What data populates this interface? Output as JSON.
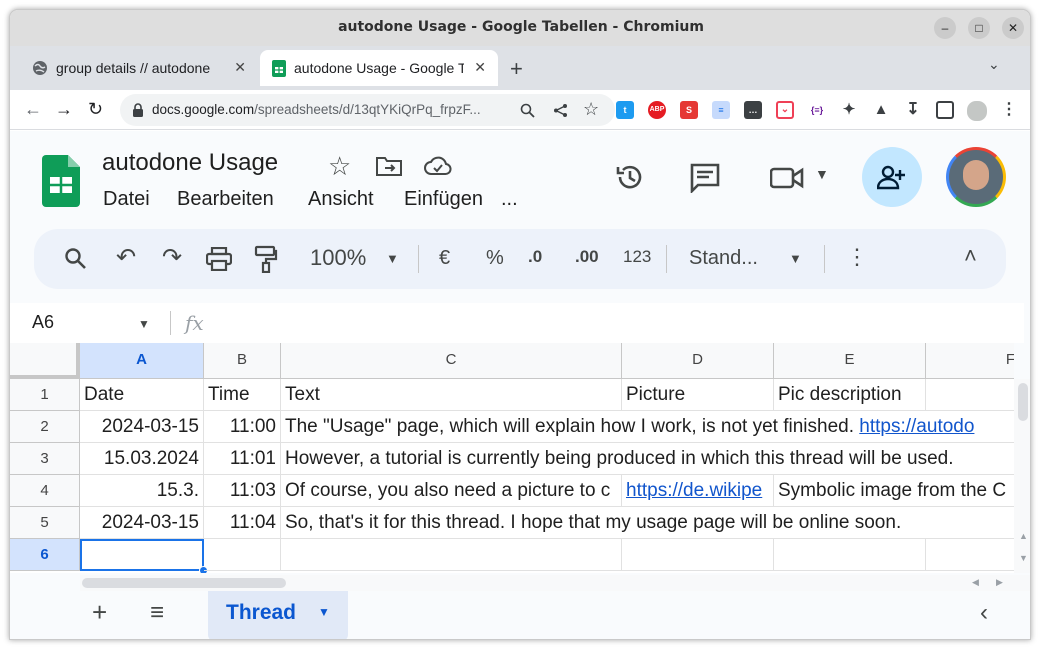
{
  "window": {
    "title": "autodone Usage - Google Tabellen - Chromium"
  },
  "tabs": [
    {
      "label": "group details // autodone",
      "active": false
    },
    {
      "label": "autodone Usage - Google Tabellen",
      "active": true
    }
  ],
  "address": {
    "host": "docs.google.com",
    "path": "/spreadsheets/d/13qtYKiQrPq_frpzF..."
  },
  "doc": {
    "title": "autodone Usage",
    "menu": [
      "Datei",
      "Bearbeiten",
      "Ansicht",
      "Einfügen",
      "..."
    ]
  },
  "toolbar": {
    "zoom": "100%",
    "currency": "€",
    "percent": "%",
    "dec_less": ".0",
    "dec_more": ".00",
    "format_123": "123",
    "font": "Stand..."
  },
  "formula_bar": {
    "name_box": "A6",
    "fx": "fx"
  },
  "columns": [
    "A",
    "B",
    "C",
    "D",
    "E",
    "F"
  ],
  "rows": [
    {
      "n": "1",
      "a": "Date",
      "b": "Time",
      "c": "Text",
      "d": "Picture",
      "e": "Pic description"
    },
    {
      "n": "2",
      "a": "2024-03-15",
      "b": "11:00",
      "c": "The \"Usage\" page, which will explain how I work, is not yet finished. ",
      "c_link": "https://autodo",
      "d": "",
      "e": ""
    },
    {
      "n": "3",
      "a": "15.03.2024",
      "b": "11:01",
      "c": "However, a tutorial is currently being produced in which this thread will be used.",
      "d": "",
      "e": ""
    },
    {
      "n": "4",
      "a": "15.3.",
      "b": "11:03",
      "c": "Of course, you also need a picture to c",
      "d": "https://de.wikipe",
      "e": "Symbolic image from the C"
    },
    {
      "n": "5",
      "a": "2024-03-15",
      "b": "11:04",
      "c": "So, that's it for this thread. I hope that my usage page will be online soon.",
      "d": "",
      "e": ""
    },
    {
      "n": "6",
      "a": "",
      "b": "",
      "c": "",
      "d": "",
      "e": ""
    }
  ],
  "sheet": {
    "name": "Thread"
  },
  "colors": {
    "accent": "#0b57d0",
    "selection": "#1a73e8",
    "sheets_green": "#0f9d58"
  }
}
